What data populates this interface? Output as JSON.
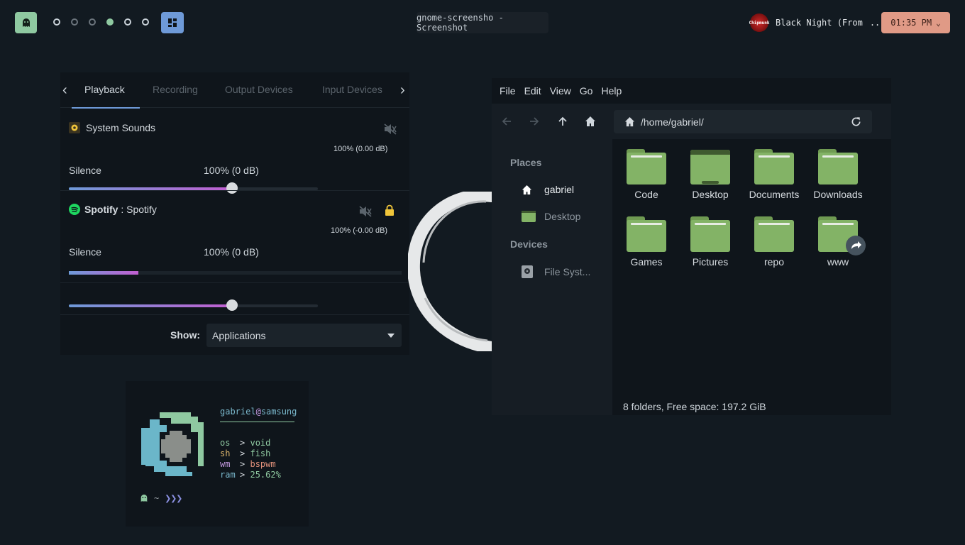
{
  "topbar": {
    "workspaces": [
      "ws1",
      "ws2",
      "ws3",
      "ws4",
      "ws5",
      "ws6"
    ],
    "active_workspace": 4,
    "window_title": "gnome-screensho - Screenshot",
    "music": {
      "album_art_text": "Chipmunk",
      "track": "Black Night (From",
      "ellipsis": "..."
    },
    "clock": "01:35 PM",
    "clock_caret": "⌄"
  },
  "sound": {
    "tabs": [
      "Playback",
      "Recording",
      "Output Devices",
      "Input Devices"
    ],
    "active_tab": "Playback",
    "streams": [
      {
        "name": "System Sounds",
        "volume_label": "100% (0.00 dB)",
        "left_label": "Silence",
        "mid_label": "100% (0 dB)",
        "level": 1.0
      },
      {
        "name_bold": "Spotify",
        "name_rest": " : Spotify",
        "volume_label": "100% (-0.00 dB)",
        "left_label": "Silence",
        "mid_label": "100% (0 dB)",
        "level": 1.0,
        "peak": 0.21
      }
    ],
    "show_label": "Show:",
    "show_value": "Applications"
  },
  "filemanager": {
    "menu": [
      "File",
      "Edit",
      "View",
      "Go",
      "Help"
    ],
    "path": "/home/gabriel/",
    "places_header": "Places",
    "places": [
      "gabriel",
      "Desktop"
    ],
    "devices_header": "Devices",
    "devices": [
      "File Syst..."
    ],
    "folders": [
      "Code",
      "Desktop",
      "Documents",
      "Downloads",
      "Games",
      "Pictures",
      "repo",
      "www"
    ],
    "status": "8 folders, Free space: 197.2 GiB"
  },
  "fetch": {
    "user": "gabriel",
    "at": "@",
    "host": "samsung",
    "rows": [
      {
        "key": "os",
        "value": "void",
        "color": "#8fc9a1"
      },
      {
        "key": "sh",
        "value": "fish",
        "color": "#8fc9a1"
      },
      {
        "key": "wm",
        "value": "bspwm",
        "color": "#c39ae0"
      },
      {
        "key": "ram",
        "value": "25.62%",
        "color": "#7ab8cc"
      }
    ],
    "sep": ">",
    "prompt_tilde": "~",
    "prompt_arrows": "❯❯❯"
  },
  "colors": {
    "accent_green": "#8fc9a1",
    "accent_blue": "#6e9ad8",
    "clock_bg": "#e09a86",
    "folder": "#83b366"
  }
}
